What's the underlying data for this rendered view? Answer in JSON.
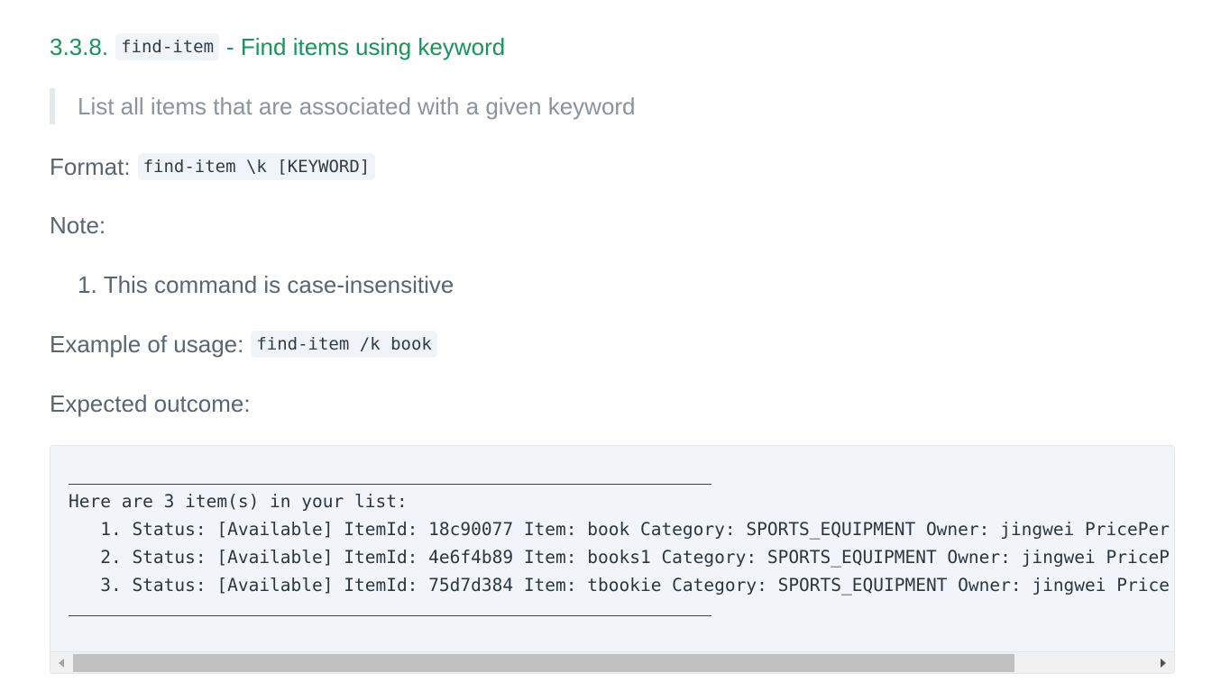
{
  "heading": {
    "number": "3.3.8.",
    "command": "find-item",
    "title": "- Find items using keyword"
  },
  "description": "List all items that are associated with a given keyword",
  "format": {
    "label": "Format:",
    "code": "find-item \\k [KEYWORD]"
  },
  "note": {
    "label": "Note:",
    "items": [
      {
        "number": "1.",
        "text": "This command is case-insensitive"
      }
    ]
  },
  "example": {
    "label": "Example of usage:",
    "code": "find-item /k book"
  },
  "expected": {
    "label": "Expected outcome:"
  },
  "output": {
    "header": "Here are 3 item(s) in your list:",
    "lines": [
      "   1. Status: [Available] ItemId: 18c90077 Item: book Category: SPORTS_EQUIPMENT Owner: jingwei PricePer",
      "   2. Status: [Available] ItemId: 4e6f4b89 Item: books1 Category: SPORTS_EQUIPMENT Owner: jingwei PriceP",
      "   3. Status: [Available] ItemId: 75d7d384 Item: tbookie Category: SPORTS_EQUIPMENT Owner: jingwei Price"
    ],
    "scroll_position": 0.0
  },
  "colors": {
    "heading": "#17955a",
    "text": "#5a6570",
    "quote_text": "#8b949c",
    "code_background": "#f1f4f9"
  }
}
